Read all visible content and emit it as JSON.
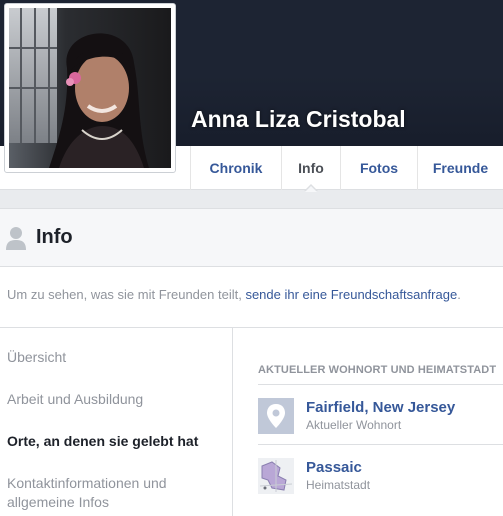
{
  "profile": {
    "name": "Anna Liza Cristobal"
  },
  "tabs": [
    {
      "label": "Chronik",
      "active": false
    },
    {
      "label": "Info",
      "active": true
    },
    {
      "label": "Fotos",
      "active": false
    },
    {
      "label": "Freunde",
      "active": false
    }
  ],
  "panel": {
    "title": "Info",
    "icon": "user-silhouette-icon"
  },
  "notice": {
    "text": "Um zu sehen, was sie mit Freunden teilt, ",
    "link": "sende ihr eine Freundschaftsanfrage",
    "suffix": "."
  },
  "left_nav": [
    {
      "label": "Übersicht",
      "active": false
    },
    {
      "label": "Arbeit und Ausbildung",
      "active": false
    },
    {
      "label": "Orte, an denen sie gelebt hat",
      "active": true
    },
    {
      "label": "Kontaktinformationen und",
      "label2": "allgemeine Infos",
      "active": false
    }
  ],
  "places": {
    "section_title": "AKTUELLER WOHNORT UND HEIMATSTADT",
    "items": [
      {
        "name": "Fairfield, New Jersey",
        "subtitle": "Aktueller Wohnort",
        "icon": "map-pin-icon"
      },
      {
        "name": "Passaic",
        "subtitle": "Heimatstadt",
        "icon": "map-thumbnail-icon"
      }
    ]
  },
  "colors": {
    "cover": "#1d2433",
    "link": "#365899",
    "muted": "#90949c",
    "panel_header": "#f6f7f9"
  }
}
